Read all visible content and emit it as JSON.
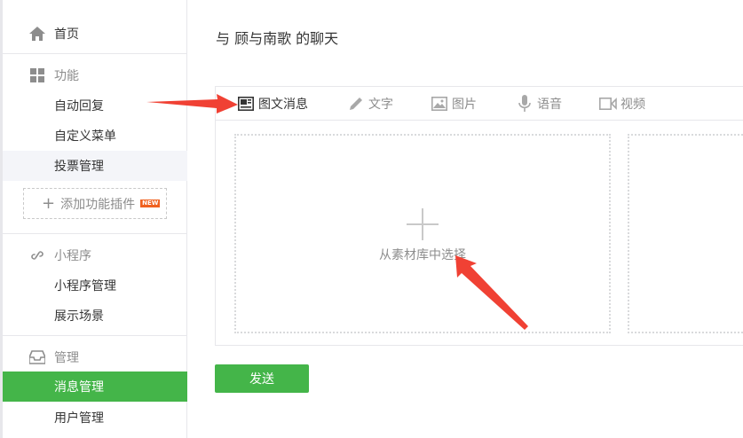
{
  "sidebar": {
    "home": "首页",
    "functions": {
      "heading": "功能",
      "items": [
        "自动回复",
        "自定义菜单",
        "投票管理"
      ],
      "add_plugin": "添加功能插件",
      "new_badge": "NEW"
    },
    "miniprogram": {
      "heading": "小程序",
      "items": [
        "小程序管理",
        "展示场景"
      ]
    },
    "manage": {
      "heading": "管理",
      "items": [
        "消息管理",
        "用户管理"
      ]
    }
  },
  "main": {
    "title": "与 顾与南歌 的聊天",
    "tabs": [
      "图文消息",
      "文字",
      "图片",
      "语音",
      "视频"
    ],
    "pick_label": "从素材库中选择",
    "send_label": "发送"
  },
  "colors": {
    "accent": "#44b549",
    "annotation_arrow": "#f04134"
  }
}
